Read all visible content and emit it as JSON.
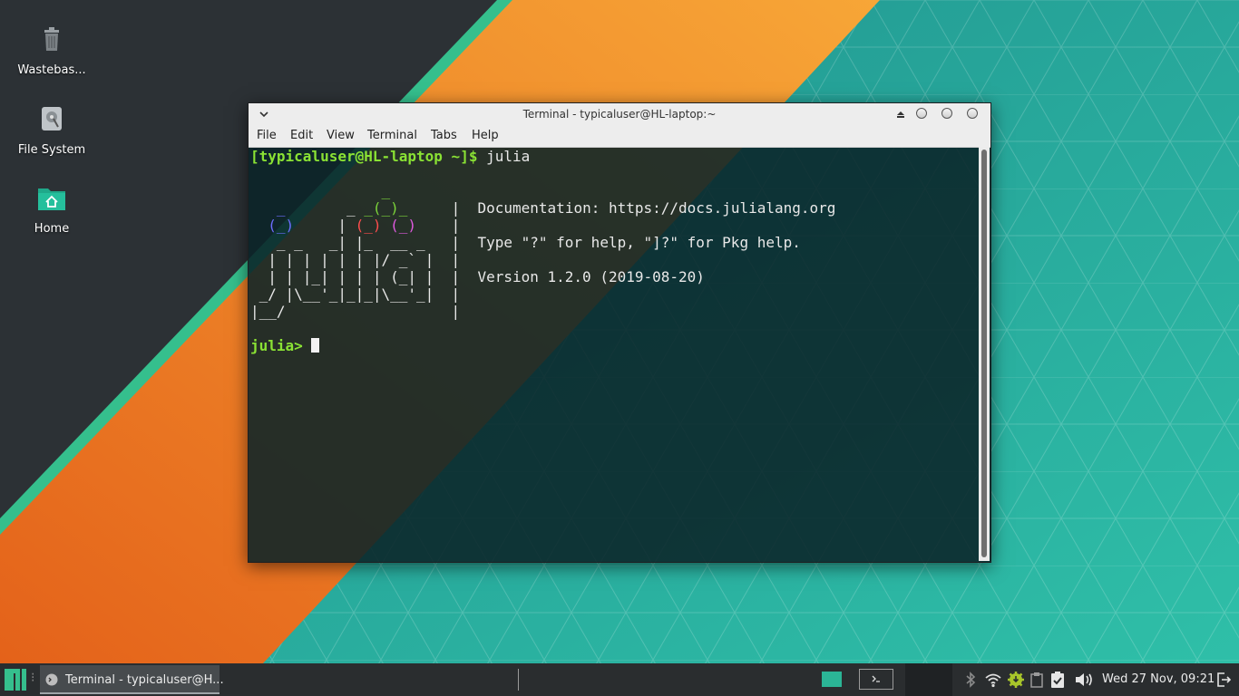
{
  "desktop": {
    "icons": [
      {
        "label": "Wastebas...",
        "icon": "trash-icon"
      },
      {
        "label": "File System",
        "icon": "drive-icon"
      },
      {
        "label": "Home",
        "icon": "home-folder-icon"
      }
    ]
  },
  "window": {
    "title": "Terminal - typicaluser@HL-laptop:~",
    "menu": [
      "File",
      "Edit",
      "View",
      "Terminal",
      "Tabs",
      "Help"
    ]
  },
  "terminal": {
    "prompt": "[typicaluser@HL-laptop ~]$",
    "command": " julia",
    "doc_line": "Documentation: https://docs.julialang.org",
    "help_line": "Type \"?\" for help, \"]?\" for Pkg help.",
    "version_line": "Version 1.2.0 (2019-08-20)",
    "julia_prompt": "julia>"
  },
  "panel": {
    "task_label": "Terminal - typicaluser@H...",
    "clock": "Wed 27 Nov, 09:21"
  },
  "colors": {
    "accent": "#35bf8d",
    "wallpaper_teal": "#2aa59c",
    "wallpaper_orange": "#e8731c",
    "prompt_green": "#8ae234"
  }
}
